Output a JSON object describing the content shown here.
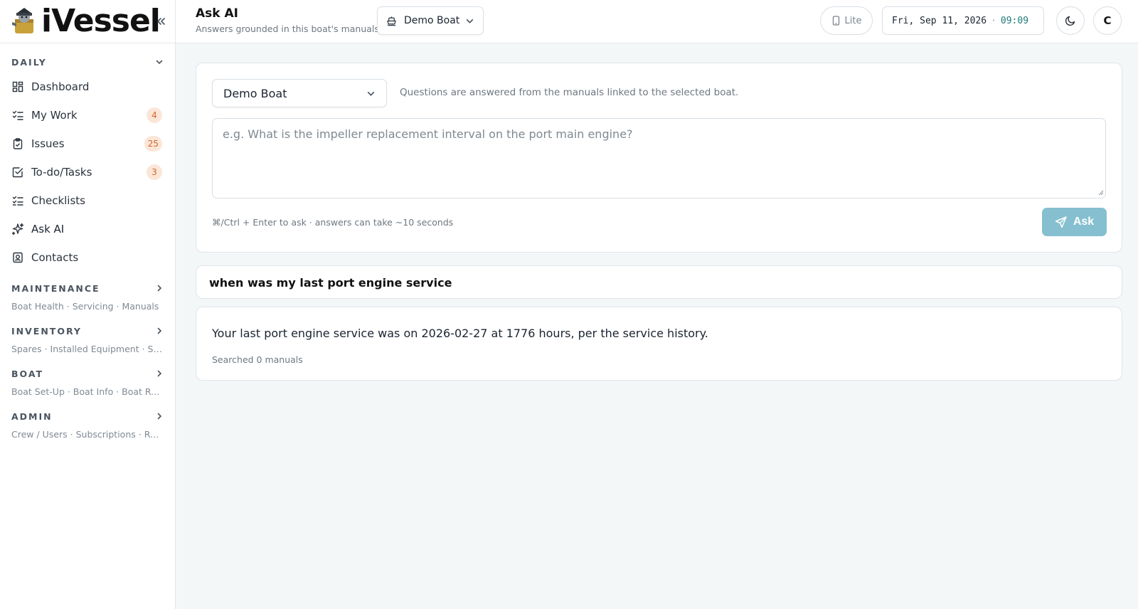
{
  "sidebar": {
    "brand": "iVessel",
    "daily": {
      "title": "DAILY",
      "items": [
        {
          "label": "Dashboard",
          "badge": null,
          "icon": "dashboard-icon"
        },
        {
          "label": "My Work",
          "badge": "4",
          "icon": "list-check-icon"
        },
        {
          "label": "Issues",
          "badge": "25",
          "icon": "clipboard-icon"
        },
        {
          "label": "To-do/Tasks",
          "badge": "3",
          "icon": "checkbox-icon"
        },
        {
          "label": "Checklists",
          "badge": null,
          "icon": "checklist-icon"
        },
        {
          "label": "Ask AI",
          "badge": null,
          "icon": "sparkles-icon"
        },
        {
          "label": "Contacts",
          "badge": null,
          "icon": "contacts-icon"
        }
      ]
    },
    "groups": [
      {
        "title": "MAINTENANCE",
        "subtitle": "Boat Health · Servicing · Manuals"
      },
      {
        "title": "INVENTORY",
        "subtitle": "Spares · Installed Equipment · Sa..."
      },
      {
        "title": "BOAT",
        "subtitle": "Boat Set-Up · Boat Info · Boat Re..."
      },
      {
        "title": "ADMIN",
        "subtitle": "Crew / Users · Subscriptions · Rec..."
      }
    ]
  },
  "topbar": {
    "title": "Ask AI",
    "subtitle": "Answers grounded in this boat's manuals",
    "boat": "Demo Boat",
    "lite": "Lite",
    "date": "Fri, Sep 11, 2026",
    "separator": "·",
    "time": "09:09",
    "avatar": "C"
  },
  "ask": {
    "boat": "Demo Boat",
    "helper": "Questions are answered from the manuals linked to the selected boat.",
    "placeholder": "e.g. What is the impeller replacement interval on the port main engine?",
    "hint": "⌘/Ctrl + Enter to ask · answers can take ~10 seconds",
    "button": "Ask"
  },
  "conversation": {
    "question": "when was my last port engine service",
    "answer": "Your last port engine service was on 2026-02-27 at 1776 hours, per the service history.",
    "meta": "Searched 0 manuals"
  },
  "colors": {
    "accent": "#86bfcf",
    "badge_bg": "#fbe6d8",
    "badge_text": "#d2692b",
    "time": "#1f7a7a"
  }
}
